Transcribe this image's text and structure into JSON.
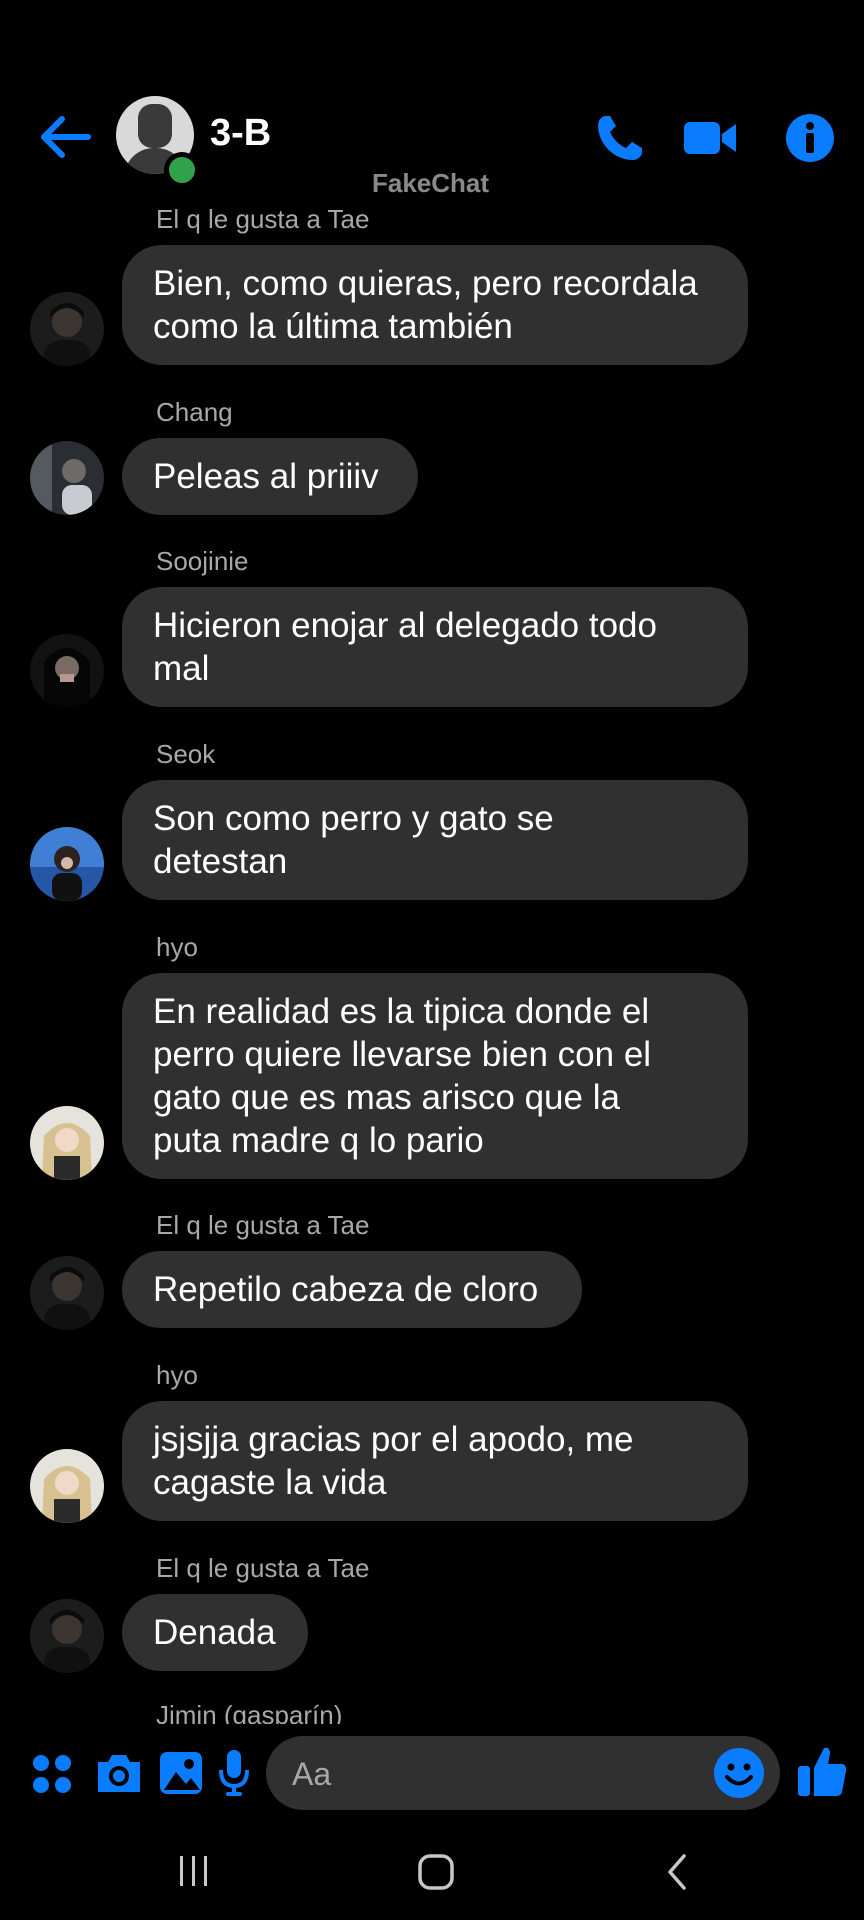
{
  "header": {
    "title": "3-B",
    "watermark": "FakeChat",
    "icons": [
      "back-arrow-icon",
      "phone-icon",
      "video-camera-icon",
      "info-icon"
    ],
    "accent": "#0a7cff"
  },
  "messages": [
    {
      "sender": "El q le gusta a Tae",
      "text_lines": [
        "Bien, como quieras, pero recordala",
        "como la última también"
      ]
    },
    {
      "sender": "Chang",
      "text_lines": [
        "Peleas al priiiv"
      ]
    },
    {
      "sender": "Soojinie",
      "text_lines": [
        "Hicieron enojar al delegado todo",
        "mal"
      ]
    },
    {
      "sender": "Seok",
      "text_lines": [
        "Son como perro y gato se",
        "detestan"
      ]
    },
    {
      "sender": "hyo",
      "text_lines": [
        "En realidad es la tipica donde el",
        "perro quiere llevarse bien con el",
        "gato que es mas arisco que la",
        "puta madre q lo pario"
      ]
    },
    {
      "sender": "El q le gusta a Tae",
      "text_lines": [
        "Repetilo cabeza de cloro"
      ]
    },
    {
      "sender": "hyo",
      "text_lines": [
        "jsjsjja gracias por el apodo, me",
        "cagaste la vida"
      ]
    },
    {
      "sender": "El q le gusta a Tae",
      "text_lines": [
        "Denada"
      ]
    },
    {
      "sender": "Jimin (gasparín)",
      "text_lines": []
    }
  ],
  "composer": {
    "placeholder": "Aa",
    "icons": [
      "apps-grid-icon",
      "camera-icon",
      "gallery-icon",
      "microphone-icon",
      "emoji-icon",
      "thumbs-up-icon"
    ]
  },
  "navbar": {
    "icons": [
      "recent-apps-icon",
      "home-icon",
      "back-icon"
    ]
  },
  "colors": {
    "background": "#000000",
    "bubble": "#303030",
    "sender_text": "#a8a8a8",
    "online": "#31a24c"
  }
}
